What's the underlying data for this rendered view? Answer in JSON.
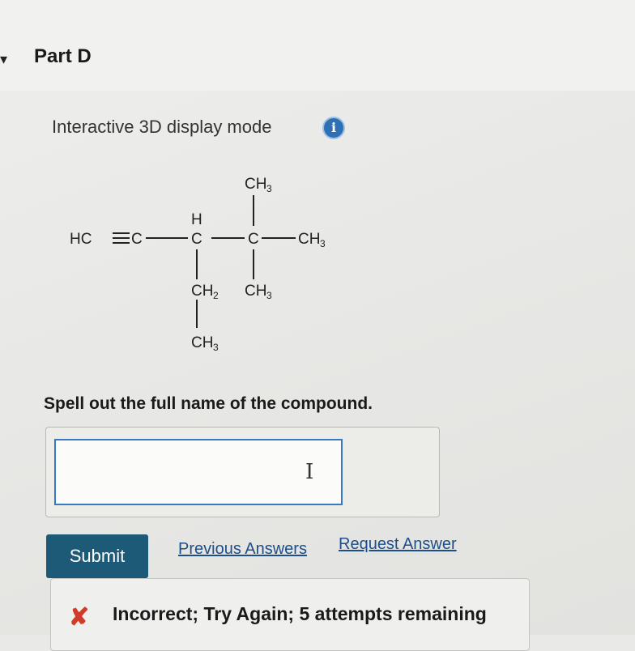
{
  "part": {
    "arrow": "▾",
    "title": "Part D"
  },
  "display": {
    "mode_label": "Interactive 3D display mode",
    "info_icon_glyph": "i",
    "info_icon_color": "#2f6fb3"
  },
  "structure": {
    "labels": {
      "hc": "HC",
      "c_alkyne": "C",
      "h_on_c3": "H",
      "c3": "C",
      "c4": "C",
      "ch3_top": "CH",
      "ch3_top_sub": "3",
      "ch3_right": "CH",
      "ch3_right_sub": "3",
      "ch2": "CH",
      "ch2_sub": "2",
      "ch3_bottom_right": "CH",
      "ch3_bottom_right_sub": "3",
      "ch3_terminal": "CH",
      "ch3_terminal_sub": "3"
    }
  },
  "question": {
    "prompt": "Spell out the full name of the compound.",
    "answer_value": "",
    "cursor_glyph": "I"
  },
  "actions": {
    "submit_label": "Submit",
    "submit_color": "#1c5a78",
    "previous_answers_label": "Previous Answers",
    "request_answer_label": "Request Answer"
  },
  "feedback": {
    "icon_glyph": "✘",
    "icon_color": "#d23a2a",
    "message": "Incorrect; Try Again; 5 attempts remaining"
  }
}
